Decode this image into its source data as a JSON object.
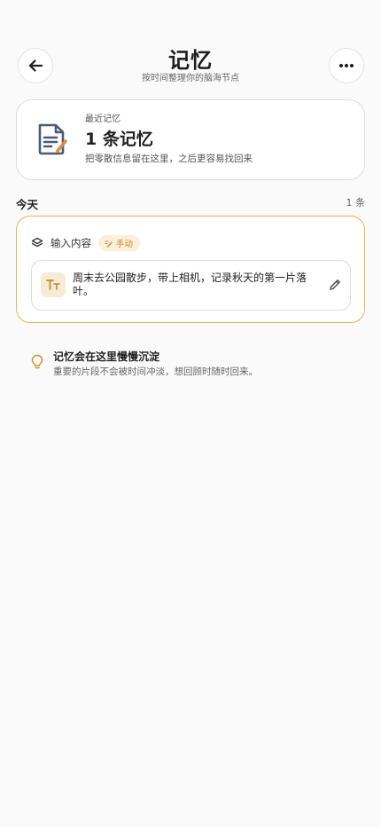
{
  "header": {
    "title": "记忆",
    "subtitle": "按时间整理你的脑海节点",
    "back_icon": "arrow-left-icon",
    "more_icon": "more-horizontal-icon"
  },
  "summary": {
    "label": "最近记忆",
    "count": "1 条记忆",
    "hint": "把零散信息留在这里，之后更容易找回来",
    "icon": "note-edit-icon"
  },
  "section": {
    "title": "今天",
    "count": "1 条"
  },
  "memory_card": {
    "head_label": "输入内容",
    "badge_label": "手动",
    "note_text": "周末去公园散步，带上相机，记录秋天的第一片落叶。",
    "type_icon": "text-type-icon",
    "edit_icon": "pencil-icon"
  },
  "tip": {
    "title": "记忆会在这里慢慢沉淀",
    "body": "重要的片段不会被时间冲淡，想回顾时随时回来。",
    "icon": "lightbulb-icon"
  },
  "colors": {
    "accent": "#e9b44a",
    "badge_bg": "#fbf0dc",
    "badge_text": "#c78a20",
    "icon_navy": "#4a5a78",
    "pen_orange": "#e08a3c"
  }
}
